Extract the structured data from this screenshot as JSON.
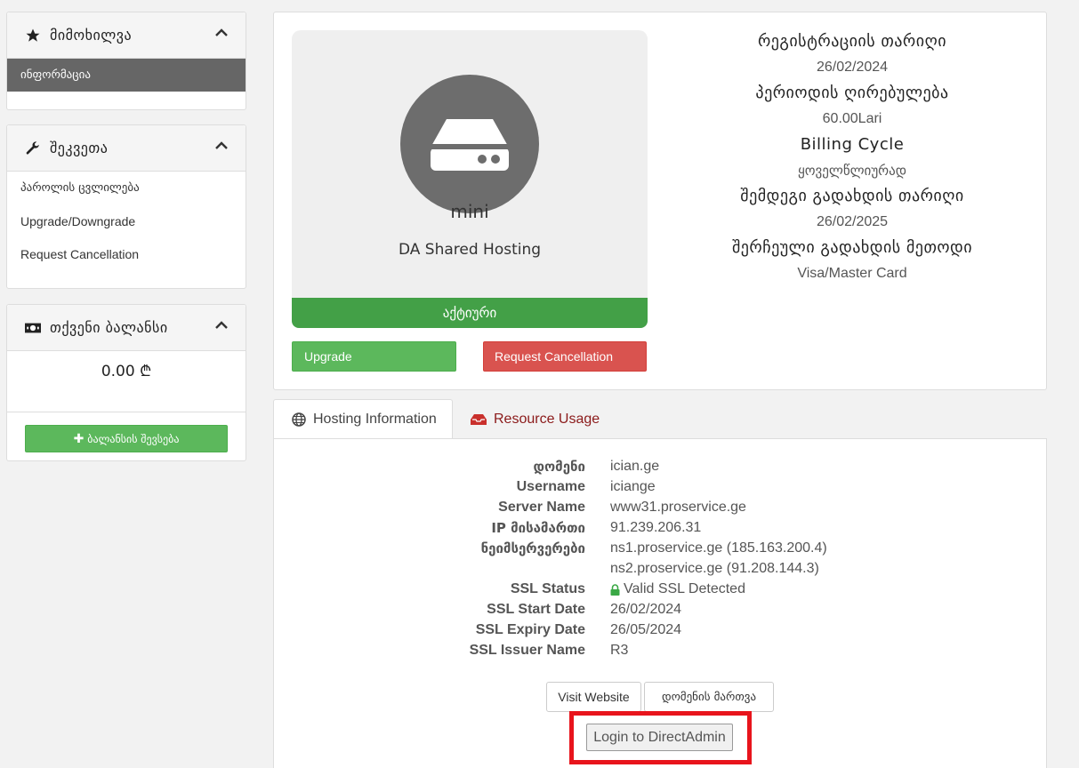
{
  "sidebar": {
    "overview": {
      "title": "მიმოხილვა",
      "icon": "star-icon",
      "item": "ინფორმაცია"
    },
    "actions": {
      "title": "შეკვეთა",
      "icon": "wrench-icon",
      "items": [
        "პაროლის ცვლილება",
        "Upgrade/Downgrade",
        "Request Cancellation"
      ]
    },
    "balance": {
      "title": "თქვენი ბალანსი",
      "icon": "money-icon",
      "amount": "0.00 ₾",
      "button": "ბალანსის შევსება"
    }
  },
  "product": {
    "name": "mini",
    "group": "DA Shared Hosting",
    "status": "აქტიური",
    "upgrade_label": "Upgrade",
    "cancel_label": "Request Cancellation",
    "icon": "server-icon"
  },
  "details": [
    {
      "label": "რეგისტრაციის თარიღი",
      "value": "26/02/2024"
    },
    {
      "label": "პერიოდის ღირებულება",
      "value": "60.00Lari"
    },
    {
      "label": "Billing Cycle",
      "value": "ყოველწლიურად"
    },
    {
      "label": "შემდეგი გადახდის თარიღი",
      "value": "26/02/2025"
    },
    {
      "label": "შერჩეული გადახდის მეთოდი",
      "value": "Visa/Master Card"
    }
  ],
  "tabs": {
    "hosting": "Hosting Information",
    "resource": "Resource Usage"
  },
  "hosting": {
    "domain_label": "დომენი",
    "domain": "ician.ge",
    "username_label": "Username",
    "username": "iciange",
    "server_label": "Server Name",
    "server": "www31.proservice.ge",
    "ip_label": "IP მისამართი",
    "ip": "91.239.206.31",
    "ns_label": "ნეიმსერვერები",
    "ns1": "ns1.proservice.ge (185.163.200.4)",
    "ns2": "ns2.proservice.ge (91.208.144.3)",
    "ssl_status_label": "SSL Status",
    "ssl_status": "Valid SSL Detected",
    "ssl_start_label": "SSL Start Date",
    "ssl_start": "26/02/2024",
    "ssl_expiry_label": "SSL Expiry Date",
    "ssl_expiry": "26/05/2024",
    "ssl_issuer_label": "SSL Issuer Name",
    "ssl_issuer": "R3"
  },
  "buttons": {
    "visit": "Visit Website",
    "manage_domain": "დომენის მართვა",
    "login_da": "Login to DirectAdmin"
  },
  "colors": {
    "success": "#5cb85c",
    "danger": "#d9534f",
    "status": "#43a047",
    "highlight": "#e8141c"
  }
}
